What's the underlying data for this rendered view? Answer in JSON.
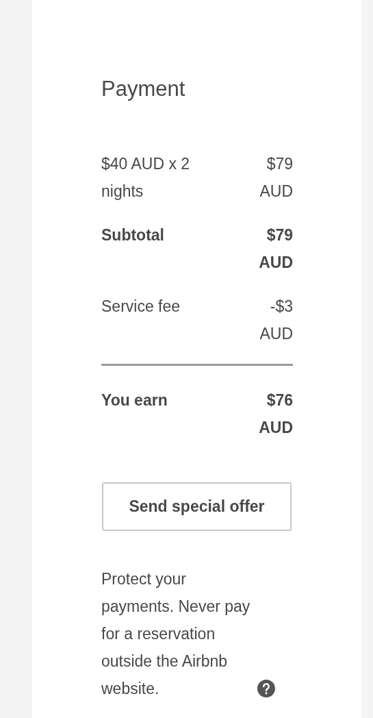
{
  "title": "Payment",
  "rows": [
    {
      "kind": "item",
      "label": "$40 AUD x 2 nights",
      "amount": "$79 AUD"
    },
    {
      "kind": "subtotal",
      "label": "Subtotal",
      "amount": "$79 AUD"
    },
    {
      "kind": "item",
      "label": "Service fee",
      "amount": "-$3 AUD"
    },
    {
      "kind": "total",
      "label": "You earn",
      "amount": "$76 AUD"
    }
  ],
  "button": "Send special offer",
  "notice": "Protect your payments. Never pay for a reservation outside the Airbnb website."
}
